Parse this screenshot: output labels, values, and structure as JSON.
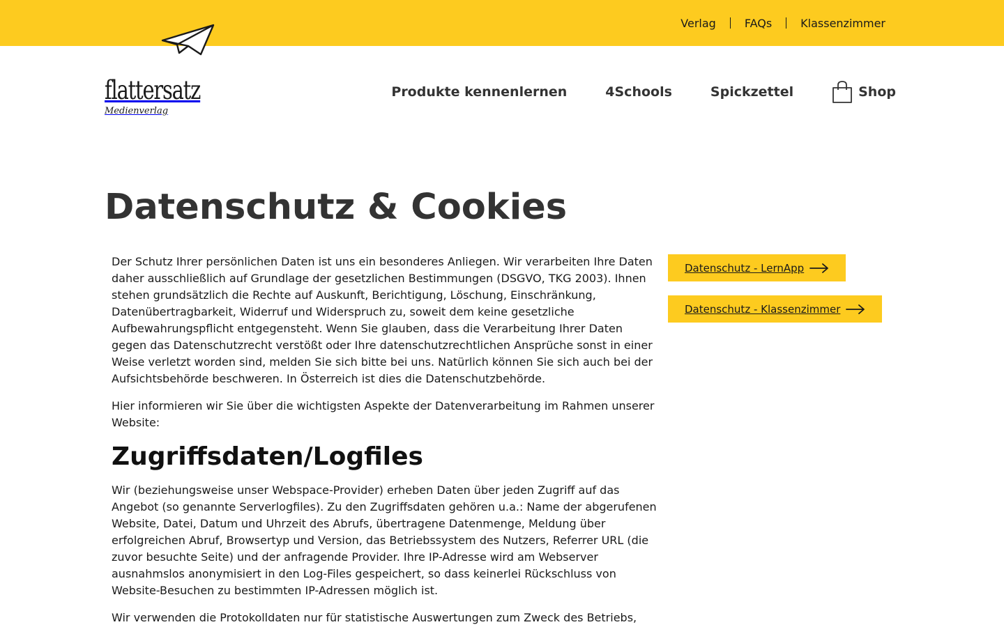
{
  "topnav": {
    "items": [
      "Verlag",
      "FAQs",
      "Klassenzimmer"
    ]
  },
  "logo": {
    "word": "flattersatz",
    "sub": "Medienverlag"
  },
  "mainnav": {
    "items": [
      "Produkte kennenlernen",
      "4Schools",
      "Spickzettel"
    ],
    "shop": "Shop"
  },
  "page": {
    "title": "Datenschutz & Cookies"
  },
  "content": {
    "p1": "Der Schutz Ihrer persönlichen Daten ist uns ein besonderes Anliegen. Wir verarbeiten Ihre Daten daher ausschließlich auf Grundlage der gesetzlichen Bestimmungen (DSGVO, TKG 2003). Ihnen stehen grundsätzlich die Rechte auf Auskunft, Berichtigung, Löschung, Einschränkung, Datenübertragbarkeit, Widerruf und Widerspruch zu, soweit dem keine gesetzliche Aufbewahrungspflicht entgegensteht. Wenn Sie glauben, dass die Verarbeitung Ihrer Daten gegen das Datenschutzrecht verstößt oder Ihre datenschutzrechtlichen Ansprüche sonst in einer Weise verletzt worden sind, melden Sie sich bitte bei uns. Natürlich können Sie sich auch bei der Aufsichtsbehörde beschweren. In Österreich ist dies die Datenschutzbehörde.",
    "p2": "Hier informieren wir Sie über die wichtigsten Aspekte der Datenverarbeitung im Rahmen unserer Website:",
    "h2": "Zugriffsdaten/Logfiles",
    "p3": "Wir (beziehungsweise unser Webspace-Provider) erheben Daten über jeden Zugriff auf das Angebot (so genannte Serverlogfiles). Zu den Zugriffsdaten gehören u.a.: Name der abgerufenen Website, Datei, Datum und Uhrzeit des Abrufs, übertragene Datenmenge, Meldung über erfolgreichen Abruf, Browsertyp und Version, das Betriebssystem des Nutzers, Referrer URL (die zuvor besuchte Seite) und der anfragende Provider. Ihre IP-Adresse wird am Webserver ausnahmslos anonymisiert in den Log-Files gespeichert, so dass keinerlei Rückschluss von Website-Besuchen zu bestimmten IP-Adressen möglich ist.",
    "p4": "Wir verwenden die Protokolldaten nur für statistische Auswertungen zum Zweck des Betriebs,"
  },
  "sidebar": {
    "buttons": [
      "Datenschutz - LernApp",
      "Datenschutz - Klassenzimmer"
    ]
  },
  "colors": {
    "accent": "#fdcb1f",
    "text": "#333333"
  },
  "icons": {
    "plane": "paper-plane-icon",
    "bag": "shopping-bag-icon",
    "arrow": "arrow-right-icon"
  }
}
